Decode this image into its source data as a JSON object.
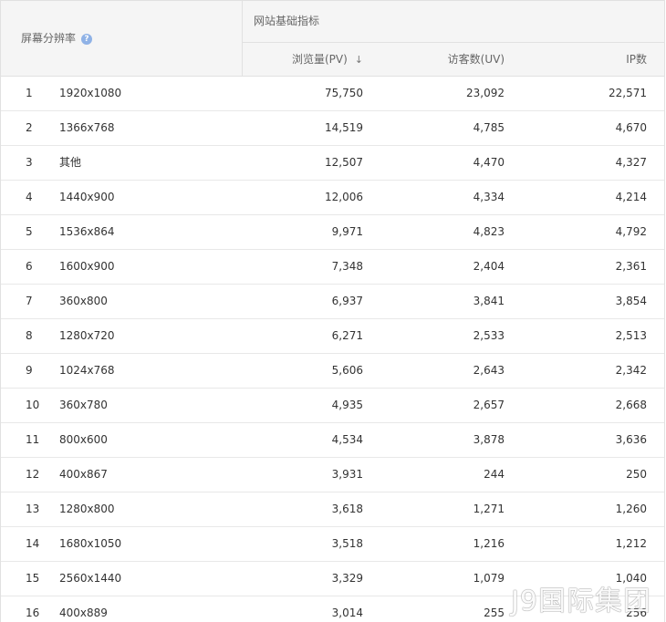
{
  "header": {
    "resolution_title": "屏幕分辨率",
    "help_icon": "?",
    "group_title": "网站基础指标",
    "col_pv": "浏览量(PV)",
    "sort_icon": "↓",
    "col_uv": "访客数(UV)",
    "col_ip": "IP数"
  },
  "rows": [
    {
      "idx": "1",
      "res": "1920x1080",
      "pv": "75,750",
      "uv": "23,092",
      "ip": "22,571"
    },
    {
      "idx": "2",
      "res": "1366x768",
      "pv": "14,519",
      "uv": "4,785",
      "ip": "4,670"
    },
    {
      "idx": "3",
      "res": "其他",
      "pv": "12,507",
      "uv": "4,470",
      "ip": "4,327"
    },
    {
      "idx": "4",
      "res": "1440x900",
      "pv": "12,006",
      "uv": "4,334",
      "ip": "4,214"
    },
    {
      "idx": "5",
      "res": "1536x864",
      "pv": "9,971",
      "uv": "4,823",
      "ip": "4,792"
    },
    {
      "idx": "6",
      "res": "1600x900",
      "pv": "7,348",
      "uv": "2,404",
      "ip": "2,361"
    },
    {
      "idx": "7",
      "res": "360x800",
      "pv": "6,937",
      "uv": "3,841",
      "ip": "3,854"
    },
    {
      "idx": "8",
      "res": "1280x720",
      "pv": "6,271",
      "uv": "2,533",
      "ip": "2,513"
    },
    {
      "idx": "9",
      "res": "1024x768",
      "pv": "5,606",
      "uv": "2,643",
      "ip": "2,342"
    },
    {
      "idx": "10",
      "res": "360x780",
      "pv": "4,935",
      "uv": "2,657",
      "ip": "2,668"
    },
    {
      "idx": "11",
      "res": "800x600",
      "pv": "4,534",
      "uv": "3,878",
      "ip": "3,636"
    },
    {
      "idx": "12",
      "res": "400x867",
      "pv": "3,931",
      "uv": "244",
      "ip": "250"
    },
    {
      "idx": "13",
      "res": "1280x800",
      "pv": "3,618",
      "uv": "1,271",
      "ip": "1,260"
    },
    {
      "idx": "14",
      "res": "1680x1050",
      "pv": "3,518",
      "uv": "1,216",
      "ip": "1,212"
    },
    {
      "idx": "15",
      "res": "2560x1440",
      "pv": "3,329",
      "uv": "1,079",
      "ip": "1,040"
    },
    {
      "idx": "16",
      "res": "400x889",
      "pv": "3,014",
      "uv": "255",
      "ip": "256"
    }
  ],
  "watermark": "J9国际集团"
}
